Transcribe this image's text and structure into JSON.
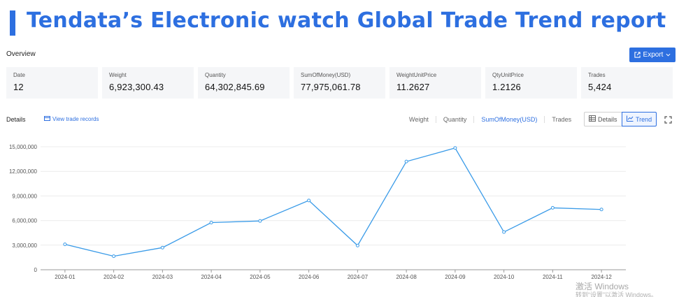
{
  "header": {
    "title": "Tendata’s Electronic watch Global Trade Trend report"
  },
  "overview": {
    "label": "Overview",
    "export_label": "Export",
    "stats": [
      {
        "label": "Date",
        "value": "12"
      },
      {
        "label": "Weight",
        "value": "6,923,300.43"
      },
      {
        "label": "Quantity",
        "value": "64,302,845.69"
      },
      {
        "label": "SumOfMoney(USD)",
        "value": "77,975,061.78"
      },
      {
        "label": "WeightUnitPrice",
        "value": "11.2627"
      },
      {
        "label": "QtyUnitPrice",
        "value": "1.2126"
      },
      {
        "label": "Trades",
        "value": "5,424"
      }
    ]
  },
  "details": {
    "label": "Details",
    "view_records": "View trade records",
    "metric_tabs": [
      "Weight",
      "Quantity",
      "SumOfMoney(USD)",
      "Trades"
    ],
    "active_metric": "SumOfMoney(USD)",
    "view_toggle": {
      "details": "Details",
      "trend": "Trend",
      "active": "Trend"
    }
  },
  "colors": {
    "accent": "#2d6fe0",
    "line": "#3a9be8"
  },
  "chart_data": {
    "type": "line",
    "categories": [
      "2024-01",
      "2024-02",
      "2024-03",
      "2024-04",
      "2024-05",
      "2024-06",
      "2024-07",
      "2024-08",
      "2024-09",
      "2024-10",
      "2024-11",
      "2024-12"
    ],
    "series": [
      {
        "values": [
          3100000,
          1650000,
          2700000,
          5750000,
          5950000,
          8450000,
          2950000,
          13200000,
          14850000,
          4600000,
          7550000,
          7350000
        ]
      }
    ],
    "yticks": [
      0,
      3000000,
      6000000,
      9000000,
      12000000,
      15000000
    ],
    "ytick_labels": [
      "0",
      "3,000,000",
      "6,000,000",
      "9,000,000",
      "12,000,000",
      "15,000,000"
    ],
    "ylim": [
      0,
      15000000
    ],
    "grid": true
  },
  "watermark": {
    "line1": "激活 Windows",
    "line2": "转到“设置”以激活 Windows。"
  }
}
